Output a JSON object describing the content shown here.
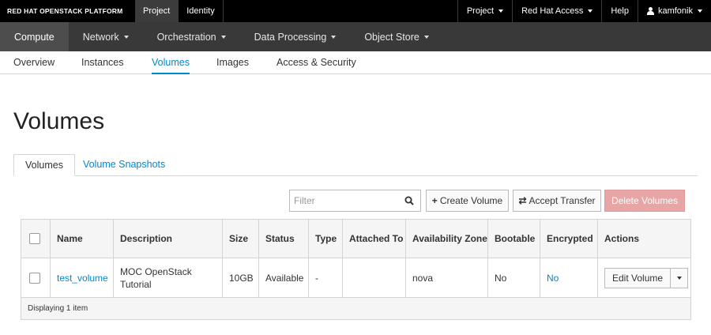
{
  "topbar": {
    "brand": "RED HAT OPENSTACK PLATFORM",
    "tabs": [
      {
        "label": "Project"
      },
      {
        "label": "Identity"
      }
    ],
    "project_menu": "Project",
    "help_menu": "Red Hat Access",
    "help": "Help",
    "user": "kamfonik"
  },
  "nav": {
    "items": [
      {
        "label": "Compute"
      },
      {
        "label": "Network"
      },
      {
        "label": "Orchestration"
      },
      {
        "label": "Data Processing"
      },
      {
        "label": "Object Store"
      }
    ]
  },
  "subnav": {
    "items": [
      {
        "label": "Overview"
      },
      {
        "label": "Instances"
      },
      {
        "label": "Volumes"
      },
      {
        "label": "Images"
      },
      {
        "label": "Access & Security"
      }
    ]
  },
  "page": {
    "title": "Volumes"
  },
  "tabs": [
    {
      "label": "Volumes"
    },
    {
      "label": "Volume Snapshots"
    }
  ],
  "toolbar": {
    "filter_placeholder": "Filter",
    "create_label": "Create Volume",
    "accept_label": "Accept Transfer",
    "delete_label": "Delete Volumes"
  },
  "table": {
    "columns": [
      "Name",
      "Description",
      "Size",
      "Status",
      "Type",
      "Attached To",
      "Availability Zone",
      "Bootable",
      "Encrypted",
      "Actions"
    ],
    "rows": [
      {
        "name": "test_volume",
        "description": "MOC OpenStack Tutorial",
        "size": "10GB",
        "status": "Available",
        "type": "-",
        "attached_to": "",
        "zone": "nova",
        "bootable": "No",
        "encrypted": "No",
        "action": "Edit Volume"
      }
    ],
    "footer": "Displaying 1 item"
  },
  "colors": {
    "accent": "#0088ce",
    "danger_button": "#e8a5a5",
    "topbar": "#000000",
    "nav": "#393939"
  }
}
